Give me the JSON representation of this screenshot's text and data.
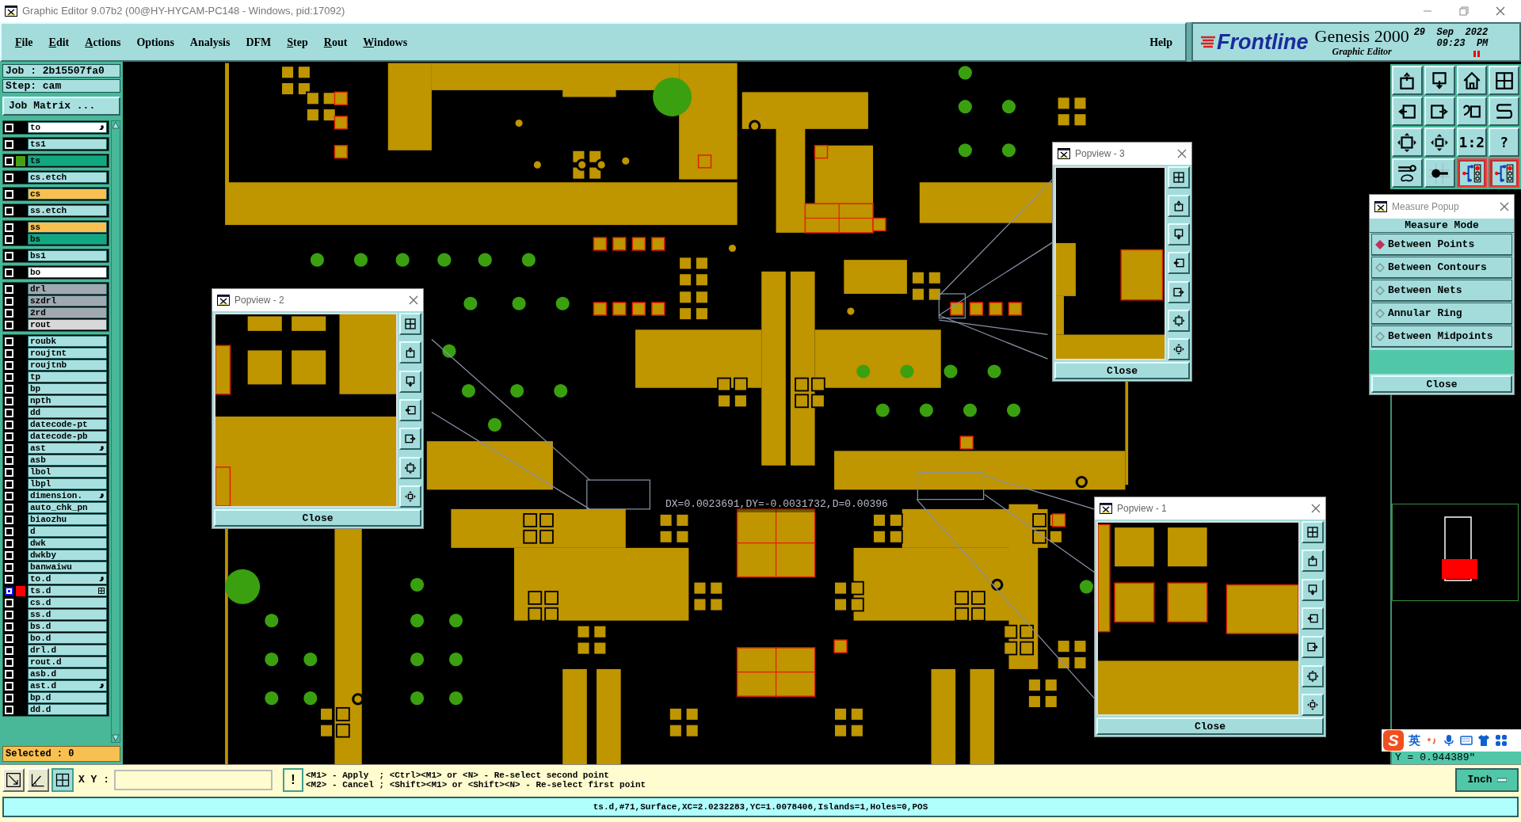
{
  "window": {
    "title": "Graphic Editor 9.07b2 (00@HY-HYCAM-PC148 - Windows, pid:17092)"
  },
  "menu": [
    {
      "label": "File",
      "underlined": true
    },
    {
      "label": "Edit",
      "underlined": true
    },
    {
      "label": "Actions",
      "underlined": true
    },
    {
      "label": "Options",
      "underlined": false
    },
    {
      "label": "Analysis",
      "underlined": false
    },
    {
      "label": "DFM",
      "underlined": false
    },
    {
      "label": "Step",
      "underlined": true
    },
    {
      "label": "Rout",
      "underlined": true
    },
    {
      "label": "Windows",
      "underlined": true
    }
  ],
  "help": "Help",
  "brand": {
    "logo": "Frontline",
    "product": "Genesis 2000",
    "subtitle": "Graphic Editor",
    "date": "29  Sep  2022",
    "time": "09:23  PM"
  },
  "job": {
    "job": "Job : 2b15507fa0",
    "step": "Step: cam",
    "matrix_button": "Job Matrix ..."
  },
  "layer_groups": [
    [
      {
        "name": "to",
        "color": "#ffffff",
        "selected": false,
        "kind": "hand"
      }
    ],
    [
      {
        "name": "ts1",
        "color": "#a8e0e0",
        "selected": false,
        "kind": "plain"
      }
    ],
    [
      {
        "name": "ts",
        "color": "#10a880",
        "selected": false,
        "kind": "plain",
        "swatch": {
          "color": "#48a010"
        }
      }
    ],
    [
      {
        "name": "cs.etch",
        "color": "#a8e0e0",
        "selected": false,
        "kind": "plain"
      }
    ],
    [
      {
        "name": "cs",
        "color": "#f8c050",
        "selected": false,
        "kind": "plain"
      }
    ],
    [
      {
        "name": "ss.etch",
        "color": "#a8e0e0",
        "selected": false,
        "kind": "plain"
      }
    ],
    [
      {
        "name": "ss",
        "color": "#f8c050",
        "selected": false,
        "kind": "plain"
      },
      {
        "name": "bs",
        "color": "#10a880",
        "selected": false,
        "kind": "plain"
      }
    ],
    [
      {
        "name": "bs1",
        "color": "#a8e0e0",
        "selected": false,
        "kind": "plain"
      }
    ],
    [
      {
        "name": "bo",
        "color": "#ffffff",
        "selected": false,
        "kind": "plain"
      }
    ],
    [
      {
        "name": "drl",
        "color": "#a0a8b0",
        "selected": false,
        "kind": "plain"
      },
      {
        "name": "szdrl",
        "color": "#a0a8b0",
        "selected": false,
        "kind": "plain"
      },
      {
        "name": "2rd",
        "color": "#a0a8b0",
        "selected": false,
        "kind": "plain"
      },
      {
        "name": "rout",
        "color": "#d8d8d8",
        "selected": false,
        "kind": "plain"
      }
    ],
    [
      {
        "name": "roubk",
        "color": "#a8e0e0",
        "selected": false,
        "kind": "plain"
      },
      {
        "name": "roujtnt",
        "color": "#a8e0e0",
        "selected": false,
        "kind": "plain"
      },
      {
        "name": "roujtnb",
        "color": "#a8e0e0",
        "selected": false,
        "kind": "plain"
      },
      {
        "name": "tp",
        "color": "#a8e0e0",
        "selected": false,
        "kind": "plain"
      },
      {
        "name": "bp",
        "color": "#a8e0e0",
        "selected": false,
        "kind": "plain"
      },
      {
        "name": "npth",
        "color": "#a8e0e0",
        "selected": false,
        "kind": "plain"
      },
      {
        "name": "dd",
        "color": "#a8e0e0",
        "selected": false,
        "kind": "plain"
      },
      {
        "name": "datecode-pt",
        "color": "#a8e0e0",
        "selected": false,
        "kind": "plain"
      },
      {
        "name": "datecode-pb",
        "color": "#a8e0e0",
        "selected": false,
        "kind": "plain"
      },
      {
        "name": "ast",
        "color": "#a8e0e0",
        "selected": false,
        "kind": "hand"
      },
      {
        "name": "asb",
        "color": "#a8e0e0",
        "selected": false,
        "kind": "plain"
      },
      {
        "name": "lbol",
        "color": "#a8e0e0",
        "selected": false,
        "kind": "plain"
      },
      {
        "name": "lbpl",
        "color": "#a8e0e0",
        "selected": false,
        "kind": "plain"
      },
      {
        "name": "dimension.",
        "color": "#a8e0e0",
        "selected": false,
        "kind": "hand"
      },
      {
        "name": "auto_chk_pn",
        "color": "#a8e0e0",
        "selected": false,
        "kind": "plain"
      },
      {
        "name": "biaozhu",
        "color": "#a8e0e0",
        "selected": false,
        "kind": "plain"
      },
      {
        "name": "d",
        "color": "#a8e0e0",
        "selected": false,
        "kind": "plain"
      },
      {
        "name": "dwk",
        "color": "#a8e0e0",
        "selected": false,
        "kind": "plain"
      },
      {
        "name": "dwkby",
        "color": "#a8e0e0",
        "selected": false,
        "kind": "plain"
      },
      {
        "name": "banwaiwu",
        "color": "#a8e0e0",
        "selected": false,
        "kind": "plain"
      },
      {
        "name": "to.d",
        "color": "#a8e0e0",
        "selected": false,
        "kind": "hand"
      },
      {
        "name": "ts.d",
        "color": "#a8e0e0",
        "selected": true,
        "kind": "grid",
        "swatch": {
          "color": "#ff0000"
        }
      },
      {
        "name": "cs.d",
        "color": "#a8e0e0",
        "selected": false,
        "kind": "plain"
      },
      {
        "name": "ss.d",
        "color": "#a8e0e0",
        "selected": false,
        "kind": "plain"
      },
      {
        "name": "bs.d",
        "color": "#a8e0e0",
        "selected": false,
        "kind": "plain"
      },
      {
        "name": "bo.d",
        "color": "#a8e0e0",
        "selected": false,
        "kind": "plain"
      },
      {
        "name": "drl.d",
        "color": "#a8e0e0",
        "selected": false,
        "kind": "plain"
      },
      {
        "name": "rout.d",
        "color": "#a8e0e0",
        "selected": false,
        "kind": "plain"
      },
      {
        "name": "asb.d",
        "color": "#a8e0e0",
        "selected": false,
        "kind": "plain"
      },
      {
        "name": "ast.d",
        "color": "#a8e0e0",
        "selected": false,
        "kind": "hand"
      },
      {
        "name": "bp.d",
        "color": "#a8e0e0",
        "selected": false,
        "kind": "plain"
      },
      {
        "name": "dd.d",
        "color": "#a8e0e0",
        "selected": false,
        "kind": "plain"
      }
    ]
  ],
  "selected_count": "Selected : 0",
  "toolbar": [
    {
      "kind": "box-up",
      "active": false
    },
    {
      "kind": "box-down",
      "active": false
    },
    {
      "kind": "home",
      "active": false
    },
    {
      "kind": "window-grid",
      "active": false
    },
    {
      "kind": "box-left",
      "active": false
    },
    {
      "kind": "box-right",
      "active": false
    },
    {
      "kind": "undo",
      "active": false
    },
    {
      "kind": "s-curve",
      "active": false
    },
    {
      "kind": "expand",
      "active": false
    },
    {
      "kind": "center",
      "active": false
    },
    {
      "kind": "text",
      "label": "1:2",
      "active": false
    },
    {
      "kind": "text",
      "label": "?",
      "active": false
    },
    {
      "kind": "tools",
      "active": false
    },
    {
      "kind": "pad",
      "active": false
    },
    {
      "kind": "net",
      "active": true
    },
    {
      "kind": "net",
      "active": true
    }
  ],
  "measure_popup": {
    "title": "Measure Popup",
    "header": "Measure Mode",
    "options": [
      {
        "label": "Between Points",
        "selected": true
      },
      {
        "label": "Between Contours",
        "selected": false
      },
      {
        "label": "Between Nets",
        "selected": false
      },
      {
        "label": "Annular Ring",
        "selected": false
      },
      {
        "label": "Between Midpoints",
        "selected": false
      }
    ],
    "close": "Close"
  },
  "popviews": [
    {
      "title": "Popview - 2",
      "close": "Close"
    },
    {
      "title": "Popview - 3",
      "close": "Close"
    },
    {
      "title": "Popview - 1",
      "close": "Close"
    }
  ],
  "measure_readout": "DX=0.0023691,DY=-0.0031732,D=0.00396",
  "ime_bar": {
    "logo": "S",
    "label": "英"
  },
  "coordinate": "Y = 0.944389\"",
  "input_bar": {
    "xy_label": "X Y :",
    "alert": "!",
    "messages": [
      "<M1> - Apply  ; <Ctrl><M1> or <N> - Re-select second point",
      "<M2> - Cancel ; <Shift><M1> or <Shift><N> - Re-select first point"
    ],
    "units": "Inch"
  },
  "status_line": "ts.d,#71,Surface,XC=2.0232283,YC=1.0078406,Islands=1,Holes=0,POS"
}
